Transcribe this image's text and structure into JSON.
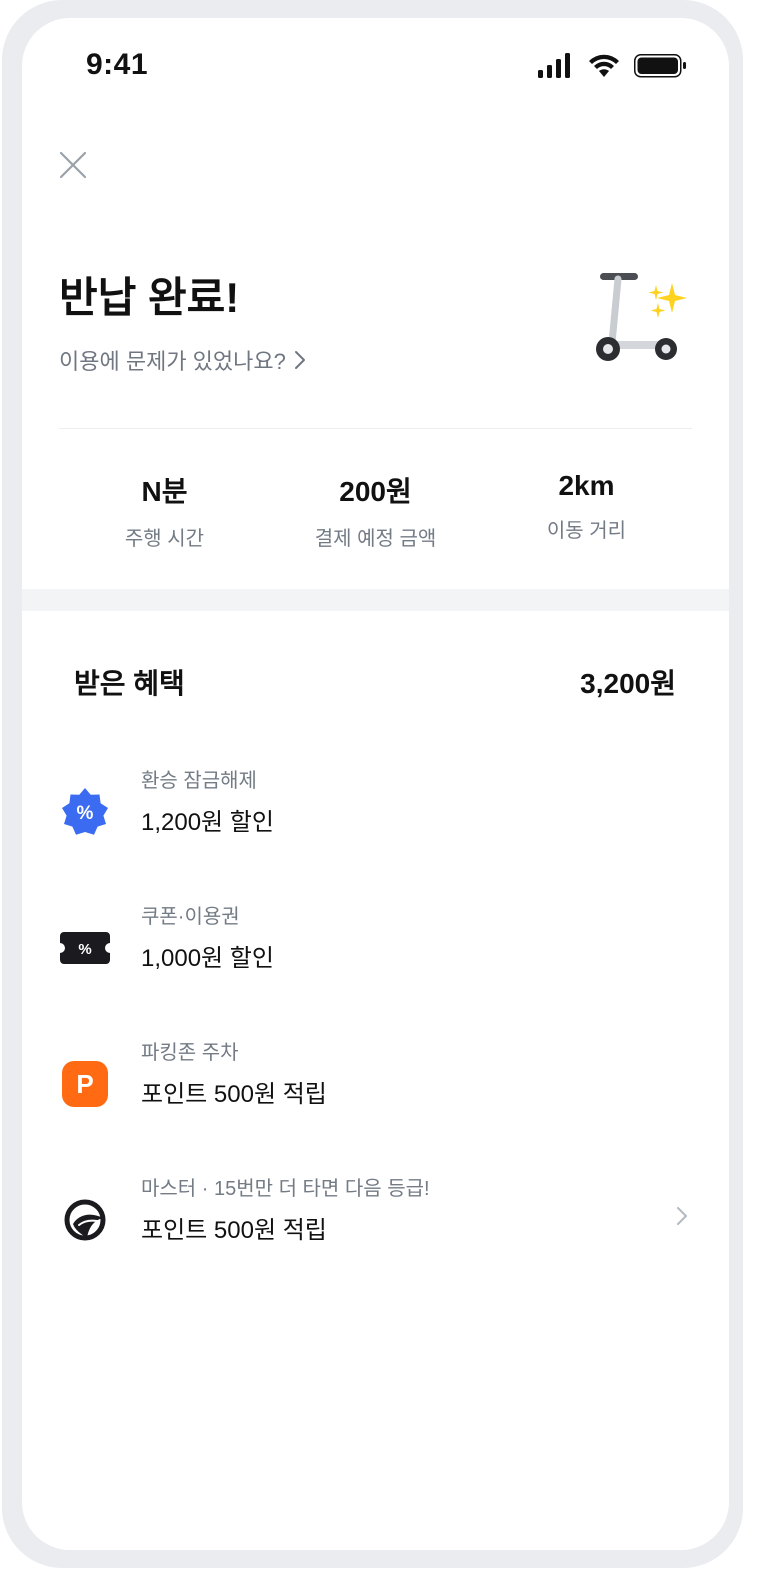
{
  "status_bar": {
    "time": "9:41"
  },
  "header": {
    "title": "반납 완료!",
    "problem_link": "이용에 문제가 있었나요?"
  },
  "stats": [
    {
      "value": "N분",
      "label": "주행 시간"
    },
    {
      "value": "200원",
      "label": "결제 예정 금액"
    },
    {
      "value": "2km",
      "label": "이동 거리"
    }
  ],
  "benefits": {
    "title": "받은 혜택",
    "total": "3,200원",
    "items": [
      {
        "icon": "percent-badge-icon",
        "sub": "환승 잠금해제",
        "main": "1,200원 할인",
        "color": "#3b6bf1"
      },
      {
        "icon": "coupon-ticket-icon",
        "sub": "쿠폰·이용권",
        "main": "1,000원 할인",
        "color": "#1b1b1f"
      },
      {
        "icon": "parking-icon",
        "sub": "파킹존 주차",
        "main": "포인트 500원 적립",
        "color": "#ff6a13"
      },
      {
        "icon": "master-grade-icon",
        "sub": "마스터 · 15번만 더 타면 다음 등급!",
        "main": "포인트 500원 적립",
        "color": "#1b1b1f"
      }
    ]
  },
  "colors": {
    "accent_blue": "#3b6bf1",
    "accent_orange": "#ff6a13",
    "sparkle": "#ffd21f",
    "muted_text": "#737b85"
  }
}
